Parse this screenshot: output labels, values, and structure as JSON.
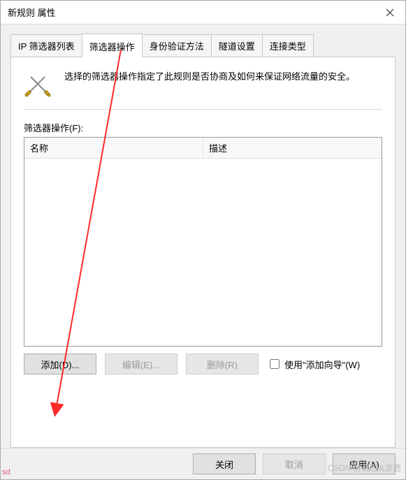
{
  "window": {
    "title": "新规则 属性"
  },
  "tabs": {
    "t0": "IP 筛选器列表",
    "t1": "筛选器操作",
    "t2": "身份验证方法",
    "t3": "隧道设置",
    "t4": "连接类型"
  },
  "description": "选择的筛选器操作指定了此规则是否协商及如何来保证网络流量的安全。",
  "list": {
    "label": "筛选器操作(F):",
    "col_name": "名称",
    "col_desc": "描述"
  },
  "buttons": {
    "add": "添加(D)...",
    "edit": "编辑(E)...",
    "remove": "删除(R)",
    "wizard": "使用\"添加向导\"(W)",
    "close": "关闭",
    "cancel": "取消",
    "apply": "应用(A)"
  },
  "watermark": "CSDN @腐蚀&渗透",
  "sd": "sd"
}
